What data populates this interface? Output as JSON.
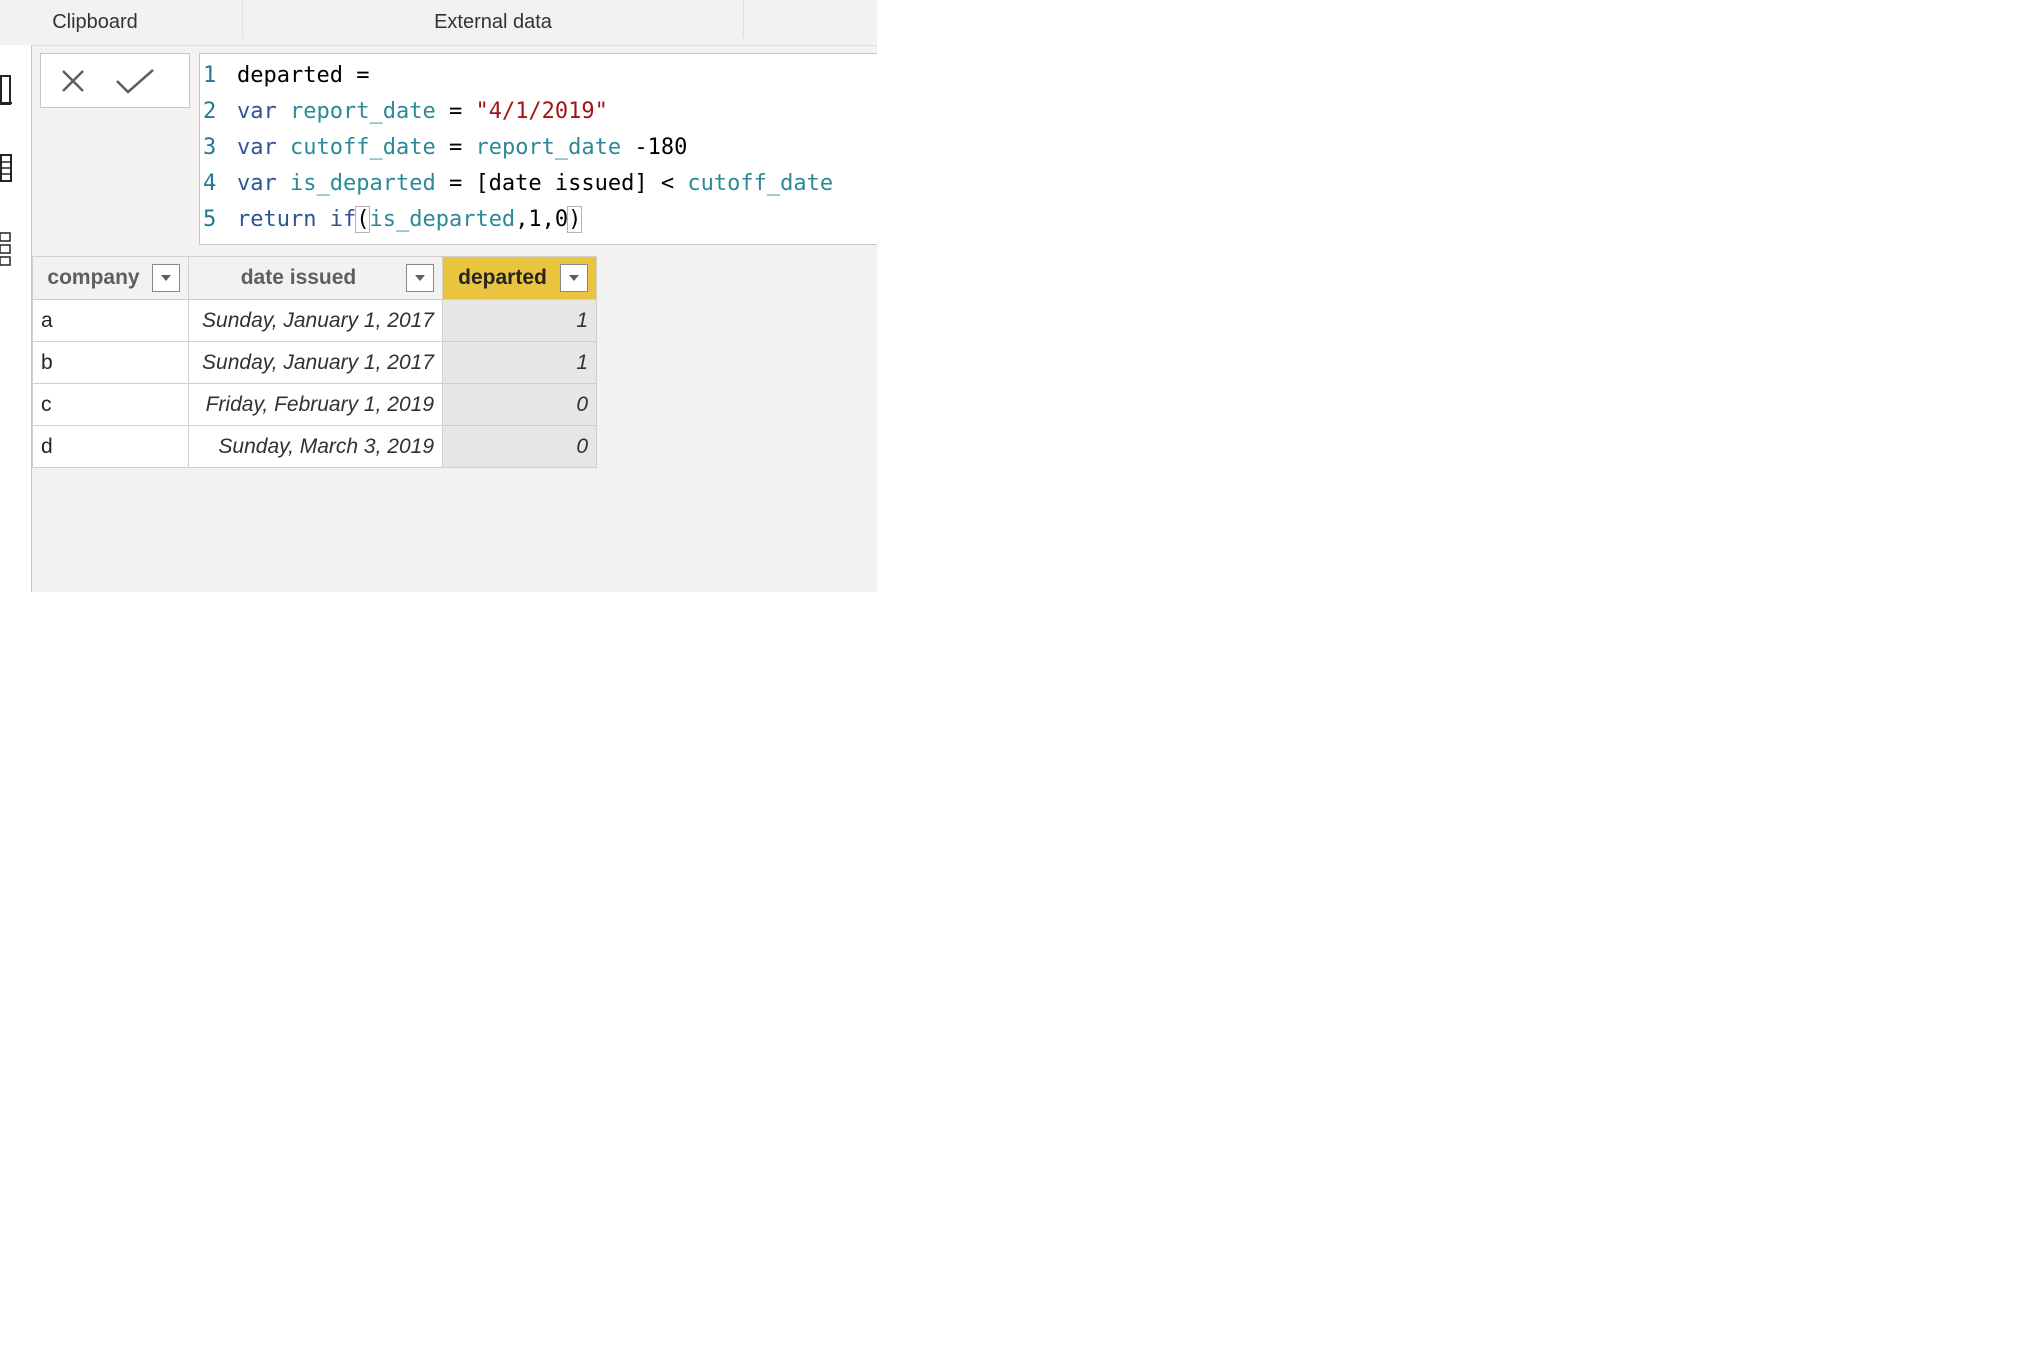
{
  "ribbon": {
    "groups": [
      {
        "label": "Clipboard"
      },
      {
        "label": "External data"
      }
    ]
  },
  "left_rail": {
    "items": [
      {
        "icon": "report-view-icon"
      },
      {
        "icon": "data-view-icon"
      },
      {
        "icon": "model-view-icon"
      }
    ]
  },
  "formula_bar": {
    "cancel_icon": "close-icon",
    "commit_icon": "checkmark-icon",
    "lines": [
      {
        "no": "1",
        "tokens": [
          {
            "t": "departed =",
            "c": "plain"
          }
        ]
      },
      {
        "no": "2",
        "tokens": [
          {
            "t": "var",
            "c": "kw"
          },
          {
            "t": " ",
            "c": "plain"
          },
          {
            "t": "report_date",
            "c": "ident"
          },
          {
            "t": " = ",
            "c": "plain"
          },
          {
            "t": "\"4/1/2019\"",
            "c": "str"
          }
        ]
      },
      {
        "no": "3",
        "tokens": [
          {
            "t": "var",
            "c": "kw"
          },
          {
            "t": " ",
            "c": "plain"
          },
          {
            "t": "cutoff_date",
            "c": "ident"
          },
          {
            "t": " = ",
            "c": "plain"
          },
          {
            "t": "report_date",
            "c": "ident"
          },
          {
            "t": " -180",
            "c": "plain"
          }
        ]
      },
      {
        "no": "4",
        "tokens": [
          {
            "t": "var",
            "c": "kw"
          },
          {
            "t": " ",
            "c": "plain"
          },
          {
            "t": "is_departed",
            "c": "ident"
          },
          {
            "t": " = [date issued] < ",
            "c": "plain"
          },
          {
            "t": "cutoff_date",
            "c": "ident"
          }
        ]
      },
      {
        "no": "5",
        "tokens": [
          {
            "t": "return",
            "c": "kw"
          },
          {
            "t": " ",
            "c": "plain"
          },
          {
            "t": "if",
            "c": "kw"
          },
          {
            "t": "(",
            "c": "paren"
          },
          {
            "t": "is_departed",
            "c": "ident"
          },
          {
            "t": ",1,0",
            "c": "plain"
          },
          {
            "t": ")",
            "c": "paren"
          }
        ]
      }
    ]
  },
  "table": {
    "columns": [
      {
        "label": "company",
        "selected": false
      },
      {
        "label": "date issued",
        "selected": false
      },
      {
        "label": "departed",
        "selected": true
      }
    ],
    "rows": [
      {
        "company": "a",
        "date_issued": "Sunday, January 1, 2017",
        "departed": "1"
      },
      {
        "company": "b",
        "date_issued": "Sunday, January 1, 2017",
        "departed": "1"
      },
      {
        "company": "c",
        "date_issued": "Friday, February 1, 2019",
        "departed": "0"
      },
      {
        "company": "d",
        "date_issued": "Sunday, March 3, 2019",
        "departed": "0"
      }
    ],
    "selected_header_color": "#e8c43f"
  }
}
